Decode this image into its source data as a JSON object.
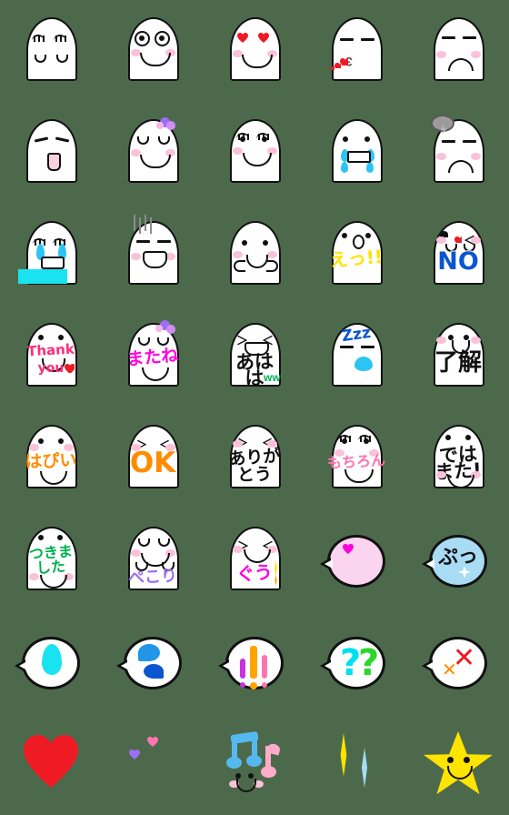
{
  "page": {
    "title": "Emoji sticker set preview",
    "background_color": "#4c6a4b",
    "grid": {
      "columns": 5,
      "rows": 8,
      "cell_size": 112,
      "total_stickers": 40
    }
  },
  "palette": {
    "outline": "#111111",
    "body": "#ffffff",
    "cheek": "#f9c2d8",
    "red": "#ee1b24",
    "cyan": "#2bc4f3",
    "magenta": "#ff00e0",
    "orange": "#ff8c00",
    "yellow": "#ffe400",
    "blue": "#0b56d0",
    "green": "#00b050",
    "purple": "#9b6ef3",
    "pink": "#ff74b0",
    "gray": "#808080",
    "lightblue": "#a8dcf5"
  },
  "stickers": [
    {
      "row": 1,
      "col": 1,
      "name": "blob-sleepy-closed-eyes",
      "kind": "blob",
      "text": "",
      "text_color": "",
      "expression": "closed lashes, two small v mouths"
    },
    {
      "row": 1,
      "col": 2,
      "name": "blob-big-eyes-smile",
      "kind": "blob",
      "text": "",
      "text_color": "",
      "expression": "big round eyes, smile, blush"
    },
    {
      "row": 1,
      "col": 3,
      "name": "blob-heart-eyes",
      "kind": "blob",
      "text": "",
      "text_color": "#ee1b24",
      "expression": "heart eyes, smile, blush"
    },
    {
      "row": 1,
      "col": 4,
      "name": "blob-kiss-hearts",
      "kind": "blob",
      "text": "",
      "text_color": "#ee1b24",
      "expression": "line eyes, blowing hearts kiss"
    },
    {
      "row": 1,
      "col": 5,
      "name": "blob-sad-frown",
      "kind": "blob",
      "text": "",
      "text_color": "",
      "expression": "line eyes, frown, blush"
    },
    {
      "row": 2,
      "col": 1,
      "name": "blob-open-mouth-pink",
      "kind": "blob",
      "text": "",
      "text_color": "",
      "expression": "slanted eyes, pink rectangular open mouth"
    },
    {
      "row": 2,
      "col": 2,
      "name": "blob-flower-crown-happy",
      "kind": "blob",
      "text": "",
      "text_color": "",
      "expression": "closed happy eyes, purple flowers, smile"
    },
    {
      "row": 2,
      "col": 3,
      "name": "blob-sparkle-eyes-smile",
      "kind": "blob",
      "text": "",
      "text_color": "",
      "expression": "sparkle lash eyes, smile, blush"
    },
    {
      "row": 2,
      "col": 4,
      "name": "blob-crying-tears",
      "kind": "blob",
      "text": "",
      "text_color": "#2bc4f3",
      "expression": "crying with blue tears, wavy mouth"
    },
    {
      "row": 2,
      "col": 5,
      "name": "blob-gloomy-cloud",
      "kind": "blob",
      "text": "",
      "text_color": "#808080",
      "expression": "gray storm cloud overhead, frown"
    },
    {
      "row": 3,
      "col": 1,
      "name": "blob-sobbing-waterfall",
      "kind": "blob",
      "text": "",
      "text_color": "#2bc4f3",
      "expression": "heavy sobbing, cyan tear puddle"
    },
    {
      "row": 3,
      "col": 2,
      "name": "blob-depressed-lines",
      "kind": "blob",
      "text": "",
      "text_color": "#808080",
      "expression": "gray vertical gloom lines, open grimace"
    },
    {
      "row": 3,
      "col": 3,
      "name": "blob-shy-hands",
      "kind": "blob",
      "text": "",
      "text_color": "",
      "expression": "small eyes, smile, two little hands"
    },
    {
      "row": 3,
      "col": 4,
      "name": "blob-surprised-etsu",
      "kind": "blob",
      "text": "えっ!!",
      "text_color": "#ffe400",
      "expression": "surprised face with yellow text"
    },
    {
      "row": 3,
      "col": 5,
      "name": "blob-no",
      "kind": "blob",
      "text": "NO",
      "text_color": "#0b56d0",
      "expression": "distressed face with blue NO"
    },
    {
      "row": 4,
      "col": 1,
      "name": "blob-thank-you",
      "kind": "blob",
      "text": "Thank\nyou♥",
      "text_color": "#ff2d7a",
      "expression": "pink handwritten Thank you with red heart"
    },
    {
      "row": 4,
      "col": 2,
      "name": "blob-matane",
      "kind": "blob",
      "text": "またね",
      "text_color": "#ff00e0",
      "expression": "flowers, closed eyes, magenta text"
    },
    {
      "row": 4,
      "col": 3,
      "name": "blob-ahaha",
      "kind": "blob",
      "text": "あは\nは",
      "text_color": "#111111",
      "expression": "laughing, black text with green marks"
    },
    {
      "row": 4,
      "col": 4,
      "name": "blob-sleeping-zzz",
      "kind": "blob",
      "text": "Zzz",
      "text_color": "#0b56d0",
      "expression": "sleeping, blue Zzz, drool bubble"
    },
    {
      "row": 4,
      "col": 5,
      "name": "blob-ryoukai",
      "kind": "blob",
      "text": "了解",
      "text_color": "#111111",
      "expression": "smiling, black kanji 了解"
    },
    {
      "row": 5,
      "col": 1,
      "name": "blob-happy-hapii",
      "kind": "blob",
      "text": "はぴい",
      "text_color": "#ff8c00",
      "expression": "orange text, smile, blush"
    },
    {
      "row": 5,
      "col": 2,
      "name": "blob-ok",
      "kind": "blob",
      "text": "OK",
      "text_color": "#ff8c00",
      "expression": "orange OK, closed eyes"
    },
    {
      "row": 5,
      "col": 3,
      "name": "blob-arigatou",
      "kind": "blob",
      "text": "ありが\nとう",
      "text_color": "#111111",
      "expression": "black handwritten ありがとう"
    },
    {
      "row": 5,
      "col": 4,
      "name": "blob-mochiron",
      "kind": "blob",
      "text": "もちろん",
      "text_color": "#ff74b0",
      "expression": "pink text, sparkle eyes, smile"
    },
    {
      "row": 5,
      "col": 5,
      "name": "blob-dewamata",
      "kind": "blob",
      "text": "では\nまた!",
      "text_color": "#111111",
      "expression": "black text ではまた!, smile"
    },
    {
      "row": 6,
      "col": 1,
      "name": "blob-tsukimashita",
      "kind": "blob",
      "text": "つきま\nした",
      "text_color": "#00b050",
      "expression": "green text つきました"
    },
    {
      "row": 6,
      "col": 2,
      "name": "blob-pekori",
      "kind": "blob",
      "text": "ぺこり",
      "text_color": "#9b6ef3",
      "expression": "bowing, purple text ぺこり"
    },
    {
      "row": 6,
      "col": 3,
      "name": "blob-guu",
      "kind": "blob",
      "text": "ぐう",
      "text_color": "#ff00e0",
      "expression": "magenta text with yellow sparkle"
    },
    {
      "row": 6,
      "col": 4,
      "name": "bubble-magenta-heart",
      "kind": "bubble",
      "text": "",
      "text_color": "#ff00e0",
      "expression": "pink bubble with magenta heart"
    },
    {
      "row": 6,
      "col": 5,
      "name": "bubble-putt",
      "kind": "bubble",
      "text": "ぷっ",
      "text_color": "#111111",
      "expression": "light blue bubble with ぷっ"
    },
    {
      "row": 7,
      "col": 1,
      "name": "bubble-sweat-drop",
      "kind": "bubble",
      "text": "",
      "text_color": "#19e3f0",
      "expression": "white bubble with cyan sweat drop"
    },
    {
      "row": 7,
      "col": 2,
      "name": "bubble-two-drops",
      "kind": "bubble",
      "text": "",
      "text_color": "#1f8fe0",
      "expression": "white bubble with two blue drops"
    },
    {
      "row": 7,
      "col": 3,
      "name": "bubble-exclamations",
      "kind": "bubble",
      "text": "!!!",
      "text_color": "#ffa500",
      "expression": "purple orange pink exclamation marks"
    },
    {
      "row": 7,
      "col": 4,
      "name": "bubble-questions",
      "kind": "bubble",
      "text": "??",
      "text_color": "#00e0f0",
      "expression": "cyan and green question marks"
    },
    {
      "row": 7,
      "col": 5,
      "name": "bubble-x-marks",
      "kind": "bubble",
      "text": "✕✕",
      "text_color": "#ee1b24",
      "expression": "red and orange X marks"
    },
    {
      "row": 8,
      "col": 1,
      "name": "icon-red-heart",
      "kind": "icon",
      "text": "",
      "text_color": "#ee1b24",
      "expression": "large red heart with black outline"
    },
    {
      "row": 8,
      "col": 2,
      "name": "icon-two-hearts",
      "kind": "icon",
      "text": "",
      "text_color": "#9b6ef3",
      "expression": "purple and pink hearts"
    },
    {
      "row": 8,
      "col": 3,
      "name": "icon-music-notes",
      "kind": "icon",
      "text": "",
      "text_color": "#55b9f0",
      "expression": "blue polka-dot note with face and pink note"
    },
    {
      "row": 8,
      "col": 4,
      "name": "icon-sparkle-diamonds",
      "kind": "icon",
      "text": "",
      "text_color": "#ffe400",
      "expression": "yellow and light blue polka-dot diamonds"
    },
    {
      "row": 8,
      "col": 5,
      "name": "icon-smiling-star",
      "kind": "icon",
      "text": "",
      "text_color": "#ffe400",
      "expression": "yellow star with smiling face"
    }
  ]
}
